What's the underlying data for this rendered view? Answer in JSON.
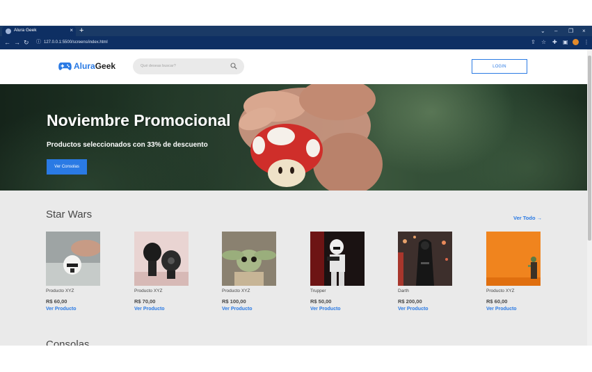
{
  "browser": {
    "tab_title": "Alura Geek",
    "tab_close": "×",
    "new_tab": "+",
    "url": "127.0.0.1:5500/screens/index.html",
    "window_controls": [
      "⌄",
      "–",
      "❐",
      "×"
    ],
    "toolbar_icons": [
      "share-icon",
      "star-icon",
      "extension-icon",
      "sidebar-icon",
      "profile-avatar",
      "menu-icon"
    ]
  },
  "header": {
    "logo_brand": "Alura",
    "logo_suffix": "Geek",
    "search_placeholder": "Qué deseas buscar?",
    "login_label": "LOGIN"
  },
  "hero": {
    "title": "Noviembre Promocional",
    "subtitle": "Productos seleccionados con 33% de descuento",
    "button": "Ver Consolas"
  },
  "section": {
    "title": "Star Wars",
    "view_all": "Ver Todo",
    "next_section": "Consolas"
  },
  "products": [
    {
      "name": "Producto XYZ",
      "price": "R$ 60,00",
      "link": "Ver Producto"
    },
    {
      "name": "Producto XYZ",
      "price": "R$ 70,00",
      "link": "Ver Producto"
    },
    {
      "name": "Producto XYZ",
      "price": "R$ 100,00",
      "link": "Ver Producto"
    },
    {
      "name": "Trupper",
      "price": "R$ 50,00",
      "link": "Ver Producto"
    },
    {
      "name": "Darth",
      "price": "R$ 200,00",
      "link": "Ver Producto"
    },
    {
      "name": "Producto XYZ",
      "price": "R$ 60,00",
      "link": "Ver Producto"
    }
  ],
  "colors": {
    "accent": "#2a7ae4",
    "browser_frame": "#1a3a66",
    "page_gray": "#eaeaea",
    "text": "#464646"
  }
}
